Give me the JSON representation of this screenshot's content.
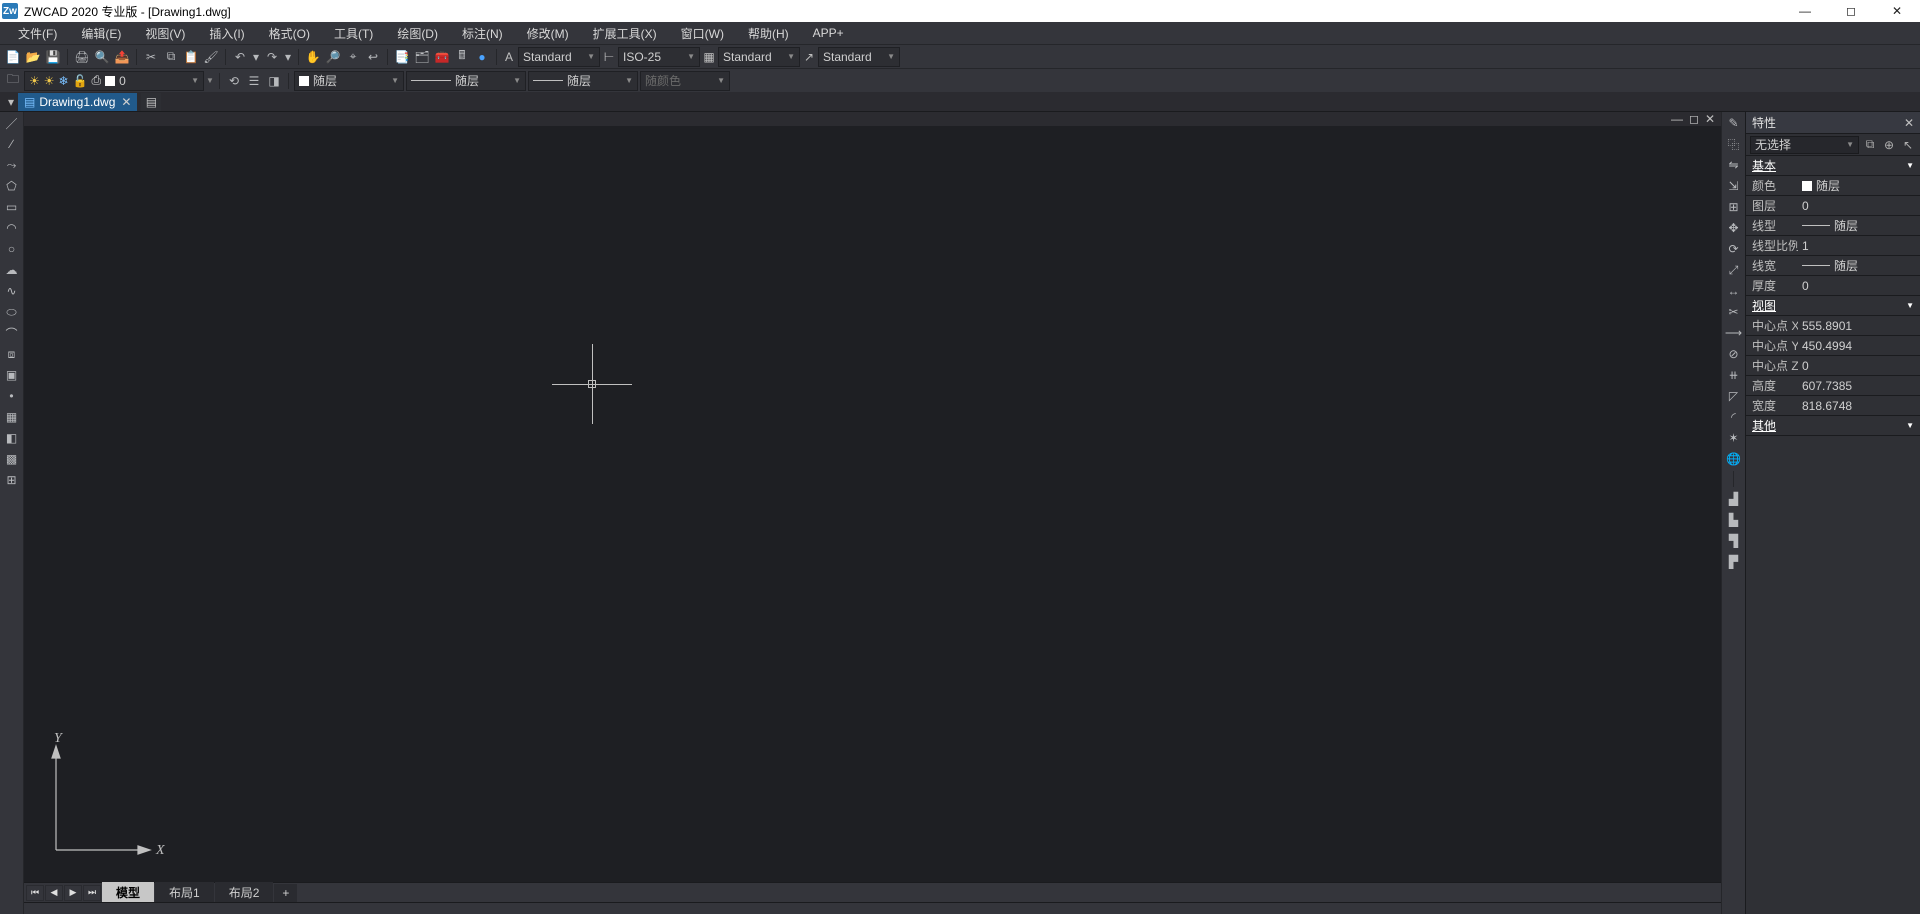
{
  "title_bar": {
    "text": "ZWCAD 2020 专业版 - [Drawing1.dwg]",
    "logo": "Zw"
  },
  "menu": [
    "文件(F)",
    "编辑(E)",
    "视图(V)",
    "插入(I)",
    "格式(O)",
    "工具(T)",
    "绘图(D)",
    "标注(N)",
    "修改(M)",
    "扩展工具(X)",
    "窗口(W)",
    "帮助(H)",
    "APP+"
  ],
  "toolbar1": {
    "std_combo1": "Standard",
    "std_combo2": "ISO-25",
    "std_combo3": "Standard",
    "std_combo4": "Standard"
  },
  "toolbar2": {
    "layer": "0",
    "color_label": "随层",
    "linetype_label": "随层",
    "lineweight_label": "随层",
    "plotstyle_label": "随颜色"
  },
  "file_tab": "Drawing1.dwg",
  "properties": {
    "title": "特性",
    "selection": "无选择",
    "sections": {
      "basic": "基本",
      "view": "视图",
      "other": "其他"
    },
    "rows_basic": [
      {
        "k": "颜色",
        "v": "随层",
        "swatch": "#ffffff"
      },
      {
        "k": "图层",
        "v": "0"
      },
      {
        "k": "线型",
        "v": "随层",
        "line": true
      },
      {
        "k": "线型比例",
        "v": "1"
      },
      {
        "k": "线宽",
        "v": "随层",
        "line": true
      },
      {
        "k": "厚度",
        "v": "0"
      }
    ],
    "rows_view": [
      {
        "k": "中心点 X",
        "v": "555.8901"
      },
      {
        "k": "中心点 Y",
        "v": "450.4994"
      },
      {
        "k": "中心点 Z",
        "v": "0"
      },
      {
        "k": "高度",
        "v": "607.7385"
      },
      {
        "k": "宽度",
        "v": "818.6748"
      }
    ]
  },
  "layout_tabs": [
    "模型",
    "布局1",
    "布局2"
  ],
  "ucs": {
    "x": "X",
    "y": "Y"
  }
}
